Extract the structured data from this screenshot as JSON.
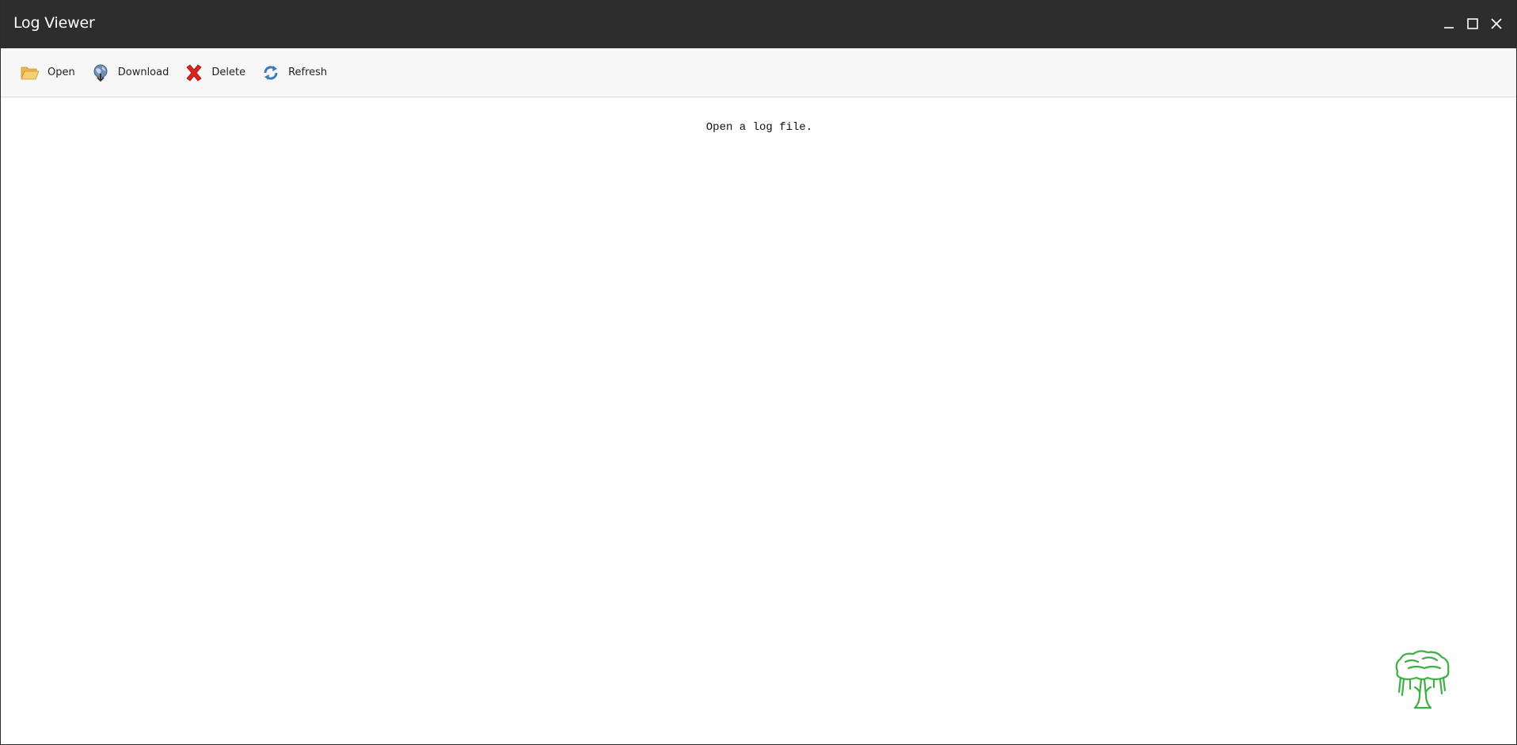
{
  "window": {
    "title": "Log Viewer",
    "controls": {
      "minimize_icon": "minimize-icon",
      "maximize_icon": "maximize-icon",
      "close_icon": "close-icon"
    }
  },
  "toolbar": {
    "open_label": "Open",
    "download_label": "Download",
    "delete_label": "Delete",
    "refresh_label": "Refresh"
  },
  "content": {
    "empty_message": "Open a log file."
  },
  "colors": {
    "titlebar": "#2d2d2d",
    "toolbar": "#f7f7f7",
    "folder": "#f0c060",
    "delete": "#d9251d",
    "refresh": "#3a7bc0",
    "logo": "#3cb043"
  }
}
